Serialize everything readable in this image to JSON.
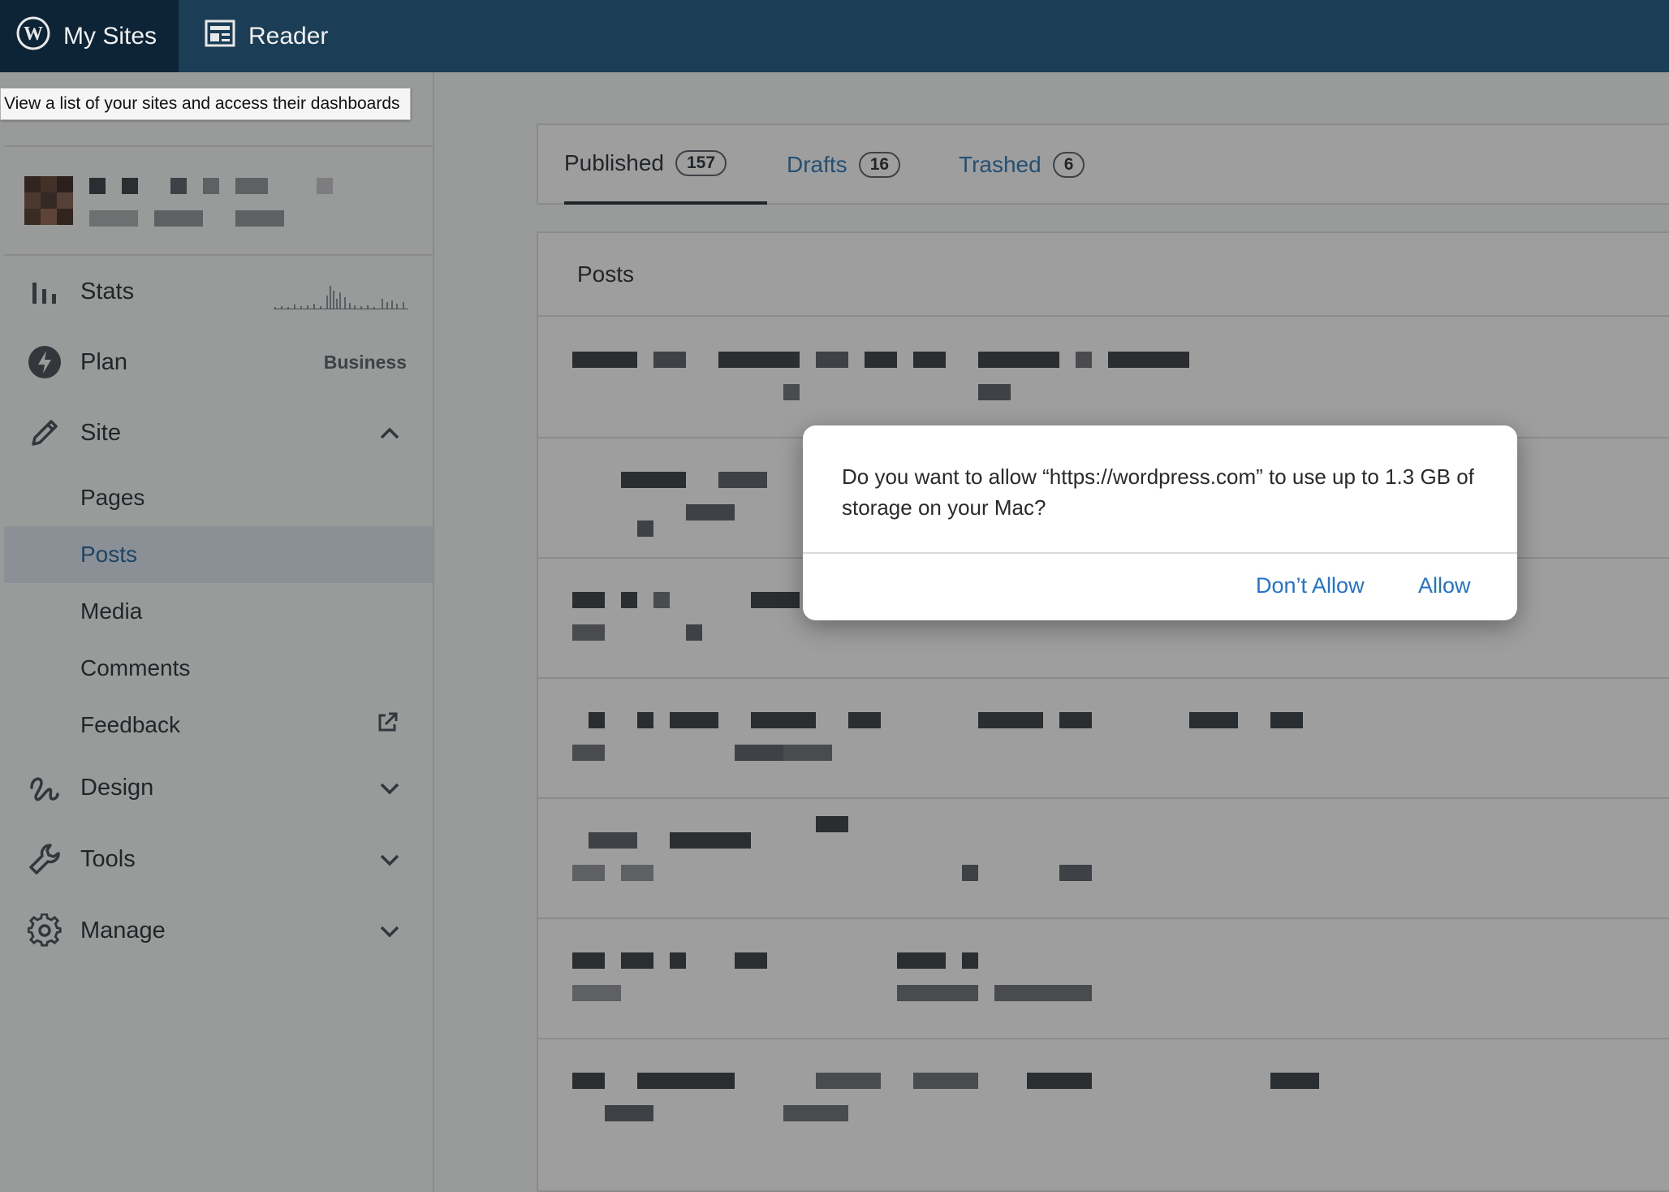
{
  "topbar": {
    "my_sites_label": "My Sites",
    "reader_label": "Reader",
    "icons": [
      "wordpress-logo-icon",
      "reader-icon"
    ]
  },
  "tooltip": {
    "text": "View a list of your sites and access their dashboards"
  },
  "sidebar": {
    "stats_label": "Stats",
    "plan_label": "Plan",
    "plan_value": "Business",
    "site_label": "Site",
    "site_sub": [
      "Pages",
      "Posts",
      "Media",
      "Comments",
      "Feedback"
    ],
    "active_sub": "Posts",
    "design_label": "Design",
    "tools_label": "Tools",
    "manage_label": "Manage"
  },
  "main": {
    "tabs": [
      {
        "label": "Published",
        "count": "157",
        "active": true
      },
      {
        "label": "Drafts",
        "count": "16",
        "active": false
      },
      {
        "label": "Trashed",
        "count": "6",
        "active": false
      }
    ],
    "posts_header": "Posts"
  },
  "dialog": {
    "message": "Do you want to allow “https://wordpress.com” to use up to 1.3 GB of storage on your Mac?",
    "deny_label": "Don’t Allow",
    "allow_label": "Allow"
  },
  "colors": {
    "topbar": "#1b3d55",
    "link": "#2271b1",
    "dialog_button": "#2273d0"
  }
}
